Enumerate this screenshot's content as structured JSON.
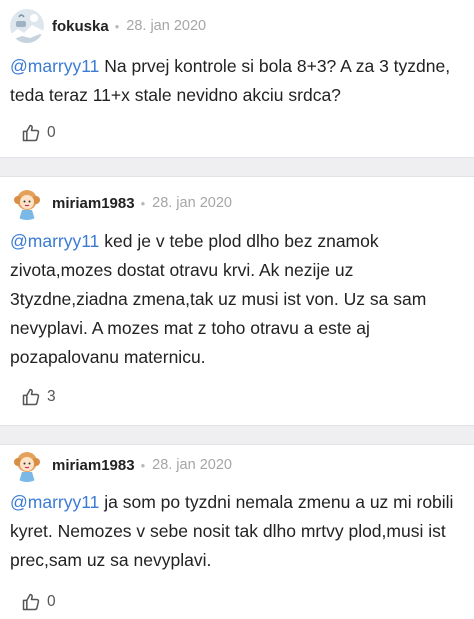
{
  "comments": [
    {
      "author": "fokuska",
      "separator": "•",
      "date": "28. jan 2020",
      "mention": "@marryy11",
      "text": " Na prvej kontrole si bola 8+3? A za 3 tyzdne, teda teraz 11+x stale nevidno akciu srdca?",
      "like_icon": "thumbs-up-icon",
      "likes": "0"
    },
    {
      "author": "miriam1983",
      "separator": "•",
      "date": "28. jan 2020",
      "mention": "@marryy11",
      "text": " ked je v tebe plod dlho bez znamok zivota,mozes dostat otravu krvi. Ak nezije uz 3tyzdne,ziadna zmena,tak uz musi ist von. Uz sa sam nevyplavi. A mozes mat z toho otravu a este aj pozapalovanu maternicu.",
      "like_icon": "thumbs-up-icon",
      "likes": "3"
    },
    {
      "author": "miriam1983",
      "separator": "•",
      "date": "28. jan 2020",
      "mention": "@marryy11",
      "text": " ja som po tyzdni nemala zmenu a uz mi robili kyret. Nemozes v sebe nosit tak dlho mrtvy plod,musi ist prec,sam uz sa nevyplavi.",
      "like_icon": "thumbs-up-icon",
      "likes": "0"
    }
  ],
  "colors": {
    "mention": "#3a7bd5",
    "separator_band": "#efeff1",
    "date": "#a6a6a6"
  }
}
